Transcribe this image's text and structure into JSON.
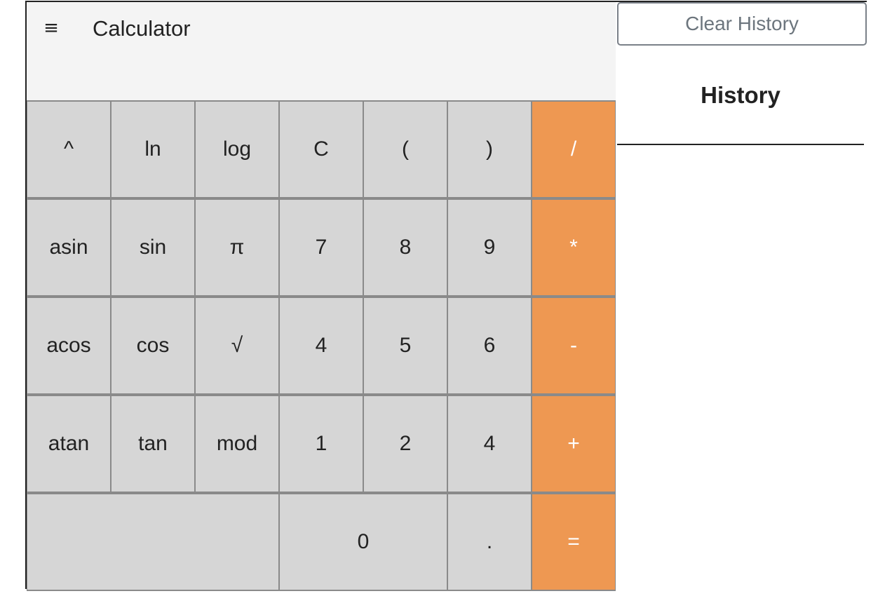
{
  "app": {
    "title": "Calculator",
    "menu_icon": "≡",
    "display_value": ""
  },
  "keypad": {
    "keys": [
      {
        "label": "^",
        "kind": "fn",
        "name": "power"
      },
      {
        "label": "ln",
        "kind": "fn",
        "name": "ln"
      },
      {
        "label": "log",
        "kind": "fn",
        "name": "log"
      },
      {
        "label": "C",
        "kind": "fn",
        "name": "clear"
      },
      {
        "label": "(",
        "kind": "fn",
        "name": "open-paren"
      },
      {
        "label": ")",
        "kind": "fn",
        "name": "close-paren"
      },
      {
        "label": "/",
        "kind": "op",
        "name": "divide"
      },
      {
        "label": "asin",
        "kind": "fn",
        "name": "asin"
      },
      {
        "label": "sin",
        "kind": "fn",
        "name": "sin"
      },
      {
        "label": "π",
        "kind": "fn",
        "name": "pi"
      },
      {
        "label": "7",
        "kind": "num",
        "name": "7"
      },
      {
        "label": "8",
        "kind": "num",
        "name": "8"
      },
      {
        "label": "9",
        "kind": "num",
        "name": "9"
      },
      {
        "label": "*",
        "kind": "op",
        "name": "multiply"
      },
      {
        "label": "acos",
        "kind": "fn",
        "name": "acos"
      },
      {
        "label": "cos",
        "kind": "fn",
        "name": "cos"
      },
      {
        "label": "√",
        "kind": "fn",
        "name": "sqrt"
      },
      {
        "label": "4",
        "kind": "num",
        "name": "4"
      },
      {
        "label": "5",
        "kind": "num",
        "name": "5"
      },
      {
        "label": "6",
        "kind": "num",
        "name": "6"
      },
      {
        "label": "-",
        "kind": "op",
        "name": "subtract"
      },
      {
        "label": "atan",
        "kind": "fn",
        "name": "atan"
      },
      {
        "label": "tan",
        "kind": "fn",
        "name": "tan"
      },
      {
        "label": "mod",
        "kind": "fn",
        "name": "mod"
      },
      {
        "label": "1",
        "kind": "num",
        "name": "1"
      },
      {
        "label": "2",
        "kind": "num",
        "name": "2"
      },
      {
        "label": "4",
        "kind": "num",
        "name": "4b"
      },
      {
        "label": "+",
        "kind": "op",
        "name": "add"
      },
      {
        "label": "",
        "kind": "blank",
        "span": 3,
        "name": "blank"
      },
      {
        "label": "0",
        "kind": "num",
        "span": 2,
        "name": "0"
      },
      {
        "label": ".",
        "kind": "num",
        "name": "decimal"
      },
      {
        "label": "=",
        "kind": "op",
        "name": "equals"
      }
    ]
  },
  "history": {
    "clear_label": "Clear History",
    "title": "History",
    "items": []
  },
  "colors": {
    "operator": "#ee9852",
    "key": "#d6d6d6",
    "display": "#f4f4f4"
  }
}
